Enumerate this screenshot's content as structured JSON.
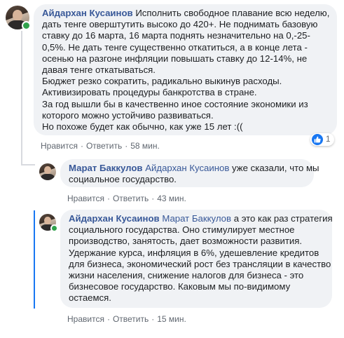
{
  "colors": {
    "link": "#385898",
    "bubble_bg": "#f0f2f5",
    "online": "#31a24c",
    "like_blue": "#1877f2",
    "meta_text": "#606770"
  },
  "comments": [
    {
      "author": "Айдархан Кусаинов",
      "mention": "",
      "lines": [
        "Исполнить свободное плавание всю неделю,",
        "дать тенге оверштутить высоко до 420+. Не поднимать базовую",
        "ставку до 16 марта, 16 марта поднять незначительно на 0,-25-",
        "0,5%. Не дать тенге существенно откатиться, а в конце лета -",
        "осенью на разгоне инфляции повышать ставку до 12-14%, не",
        "давая тенге откатываться.",
        "Бюджет резко сократить, радикально выкинув расходы.",
        "Активизировать процедуры банкротства в стране.",
        "За год вышли бы в качественно иное состояние экономики из",
        "которого можно устойчиво развиваться.",
        "Но похоже будет как обычно, как уже 15 лет :(("
      ],
      "like_label": "Нравится",
      "reply_label": "Ответить",
      "time": "58 мин.",
      "reaction_count": "1",
      "reaction_icon": "like-icon"
    },
    {
      "author": "Марат Баккулов",
      "mention": "Айдархан Кусаинов",
      "lines": [
        "уже сказали, что мы",
        "социальное государство."
      ],
      "like_label": "Нравится",
      "reply_label": "Ответить",
      "time": "43 мин."
    },
    {
      "author": "Айдархан Кусаинов",
      "mention": "Марат Баккулов",
      "lines": [
        "а это как раз стратегия",
        "социального государства. Оно стимулирует местное",
        "производство, занятость, дает возможности развития.",
        "Удержание курса, инфляция в 6%, удешевление кредитов",
        "для бизнеса, экономический рост без трансляции в качество",
        "жизни населения, снижение налогов для бизнеса - это",
        "бизнесовое государство. Каковым мы по-видимому",
        "остаемся."
      ],
      "like_label": "Нравится",
      "reply_label": "Ответить",
      "time": "15 мин."
    }
  ]
}
